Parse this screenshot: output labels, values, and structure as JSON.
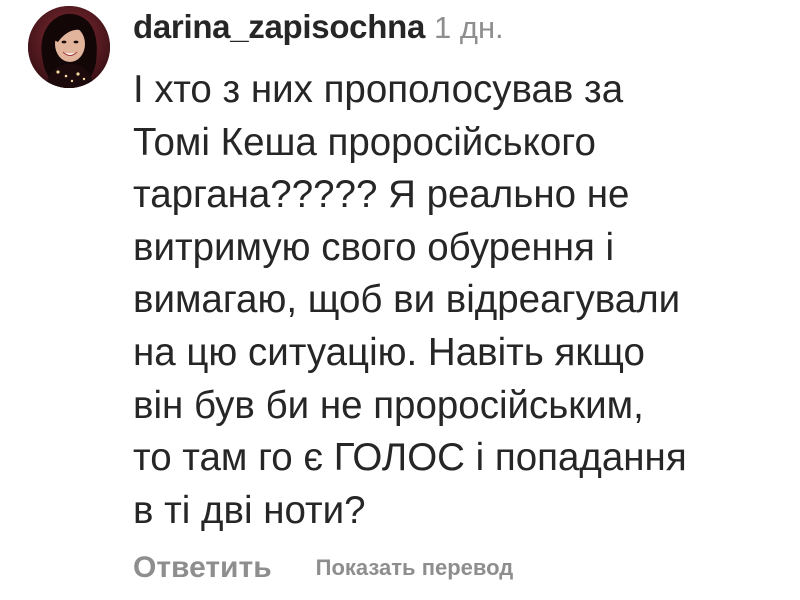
{
  "comment": {
    "username": "darina_zapisochna",
    "time": "1 дн.",
    "lines": [
      "І хто з них прополосував за",
      "Томі Кеша проросійського",
      "таргана????? Я реально не",
      "витримую свого обурення і",
      "вимагаю, щоб ви відреагували",
      "на цю ситуацію. Навіть якщо",
      "він був би не проросійським,",
      "то там го є ГОЛОС і попадання",
      "в ті дві ноти?"
    ],
    "reply_label": "Ответить",
    "translate_label": "Показать перевод"
  },
  "colors": {
    "text": "#262626",
    "secondary": "#8e8e8e",
    "background": "#ffffff"
  }
}
